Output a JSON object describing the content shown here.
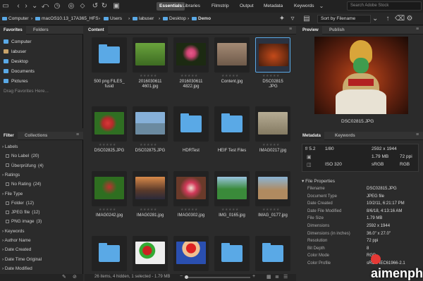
{
  "toolbar": {
    "tabs": [
      "Essentials",
      "Libraries",
      "Filmstrip",
      "Output",
      "Metadata",
      "Keywords"
    ],
    "active_tab": "Essentials",
    "search_placeholder": "Search Adobe Stock"
  },
  "path": {
    "items": [
      "Computer",
      "macOS10.13_17A365_HFS",
      "Users",
      "labuser",
      "Desktop",
      "Demo"
    ],
    "sort_label": "Sort by Filename"
  },
  "left": {
    "tabs": [
      "Favorites",
      "Folders"
    ],
    "favorites": [
      "Computer",
      "labuser",
      "Desktop",
      "Documents",
      "Pictures"
    ],
    "drag_hint": "Drag Favorites Here...",
    "filter_tabs": [
      "Filter",
      "Collections"
    ],
    "filters": [
      {
        "type": "head",
        "label": "Labels"
      },
      {
        "type": "item",
        "label": "No Label",
        "count": "(20)"
      },
      {
        "type": "item",
        "label": "Überprüfung",
        "count": "(4)"
      },
      {
        "type": "head",
        "label": "Ratings"
      },
      {
        "type": "item",
        "label": "No Rating",
        "count": "(24)"
      },
      {
        "type": "head",
        "label": "File Type"
      },
      {
        "type": "item",
        "label": "Folder",
        "count": "(12)"
      },
      {
        "type": "item",
        "label": "JPEG file",
        "count": "(12)"
      },
      {
        "type": "item",
        "label": "PNG image",
        "count": "(3)"
      },
      {
        "type": "head",
        "label": "Keywords"
      },
      {
        "type": "head",
        "label": "Author Name"
      },
      {
        "type": "head",
        "label": "Date Created"
      },
      {
        "type": "head",
        "label": "Date Time Original"
      },
      {
        "type": "head",
        "label": "Date Modified"
      }
    ]
  },
  "content": {
    "tab": "Content",
    "status": "26 items, 4 hidden, 1 selected - 1.79 MB",
    "items": [
      {
        "name": "500 png FILES_\nfusid",
        "kind": "folder",
        "stars": false
      },
      {
        "name": "2016030611\n4601.jpg",
        "kind": "photo",
        "stars": true,
        "dot": true
      },
      {
        "name": "2016030611\n4822.jpg",
        "kind": "photo",
        "stars": true,
        "dot": true
      },
      {
        "name": "Content.jpg",
        "kind": "photo",
        "stars": true,
        "dot": true
      },
      {
        "name": "DSC02815\n.JPG",
        "kind": "photo",
        "stars": true,
        "dot": true,
        "selected": true
      },
      {
        "name": "DSC02825.JPG",
        "kind": "photo",
        "stars": true
      },
      {
        "name": "DSC02875.JPG",
        "kind": "photo",
        "stars": true
      },
      {
        "name": "HDRTest",
        "kind": "folder"
      },
      {
        "name": "HEIF Test Files",
        "kind": "folder"
      },
      {
        "name": "IMAG0217.jpg",
        "kind": "photo",
        "stars": true
      },
      {
        "name": "IMAG0242.jpg",
        "kind": "photo",
        "stars": true
      },
      {
        "name": "IMAG0281.jpg",
        "kind": "photo",
        "stars": true
      },
      {
        "name": "IMAG0302.jpg",
        "kind": "photo",
        "stars": true
      },
      {
        "name": "IMG_0165.jpg",
        "kind": "photo",
        "stars": true
      },
      {
        "name": "IMAG_0177.jpg",
        "kind": "photo",
        "stars": true
      },
      {
        "name": "",
        "kind": "folder"
      },
      {
        "name": "",
        "kind": "photo"
      },
      {
        "name": "",
        "kind": "photo"
      },
      {
        "name": "",
        "kind": "folder"
      },
      {
        "name": "",
        "kind": "folder"
      }
    ]
  },
  "preview": {
    "tabs": [
      "Preview",
      "Publish"
    ],
    "caption": "DSC02815.JPG"
  },
  "metadata": {
    "tabs": [
      "Metadata",
      "Keywords"
    ],
    "summary": {
      "fstop": "f/ 5.2",
      "shutter": "1/80",
      "dims": "2592 x 1944",
      "size": "1.79 MB",
      "ppi": "72 ppi",
      "iso": "ISO 320",
      "cs": "sRGB",
      "mode": "RGB"
    },
    "section": "File Properties",
    "rows": [
      {
        "label": "Filename",
        "value": "DSC02815.JPG"
      },
      {
        "label": "Document Type",
        "value": "JPEG file"
      },
      {
        "label": "Date Created",
        "value": "10/2/11, 6:21:17 PM"
      },
      {
        "label": "Date File Modified",
        "value": "8/6/18, 4:13:16 AM"
      },
      {
        "label": "File Size",
        "value": "1.79 MB"
      },
      {
        "label": "Dimensions",
        "value": "2592 x 1944"
      },
      {
        "label": "Dimensions (in inches)",
        "value": "36.0\" x 27.0\""
      },
      {
        "label": "Resolution",
        "value": "72 ppi"
      },
      {
        "label": "Bit Depth",
        "value": "8"
      },
      {
        "label": "Color Mode",
        "value": "RGB"
      },
      {
        "label": "Color Profile",
        "value": "sRGB IEC61966-2.1"
      }
    ]
  },
  "watermark": "aimenphi"
}
